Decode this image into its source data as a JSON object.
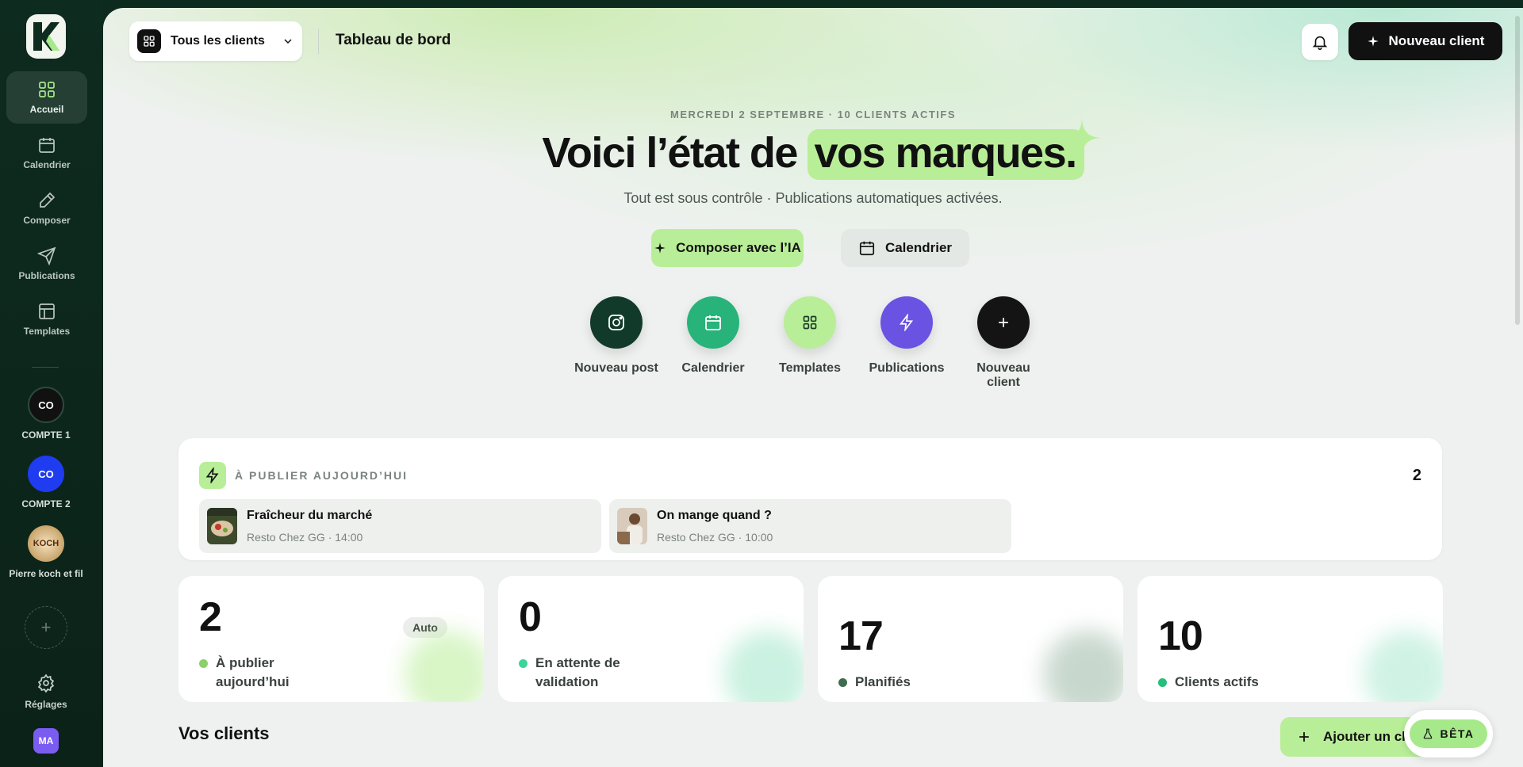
{
  "sidebar": {
    "logo_letter": "K",
    "nav": [
      {
        "label": "Accueil",
        "icon": "grid-icon",
        "active": true
      },
      {
        "label": "Calendrier",
        "icon": "calendar-icon"
      },
      {
        "label": "Composer",
        "icon": "pencil-icon"
      },
      {
        "label": "Publications",
        "icon": "send-icon"
      },
      {
        "label": "Templates",
        "icon": "layout-icon"
      }
    ],
    "accounts": [
      {
        "initials": "CO",
        "label": "COMPTE 1",
        "color": "#111111"
      },
      {
        "initials": "CO",
        "label": "COMPTE 2",
        "color": "#1f3cf0"
      },
      {
        "initials": "KOCH",
        "label": "Pierre koch et fil",
        "color": "#c9a46a"
      }
    ],
    "add_account_symbol": "+",
    "settings_label": "Réglages",
    "user_initials": "MA"
  },
  "topbar": {
    "client_select": "Tous les clients",
    "page_title": "Tableau de bord",
    "new_client_button": "Nouveau client"
  },
  "hero": {
    "date_line": "MERCREDI 2 SEPTEMBRE · 10 CLIENTS ACTIFS",
    "title_prefix": "Voici l’état de ",
    "title_highlight": "vos marques.",
    "subtitle": "Tout est sous contrôle · Publications automatiques activées.",
    "primary_button": "Composer avec l’IA",
    "secondary_button": "Calendrier"
  },
  "quick_actions": [
    {
      "label": "Nouveau post",
      "icon": "instagram-icon",
      "color": "#123a2a"
    },
    {
      "label": "Calendrier",
      "icon": "calendar-icon",
      "color": "#27b37a"
    },
    {
      "label": "Templates",
      "icon": "grid-icon",
      "color": "#b9ee98"
    },
    {
      "label": "Publications",
      "icon": "bolt-icon",
      "color": "#6a52e3"
    },
    {
      "label": "Nouveau client",
      "icon": "plus-icon",
      "color": "#141414"
    }
  ],
  "publish_today": {
    "title": "À PUBLIER AUJOURD’HUI",
    "count": "2",
    "posts": [
      {
        "title": "Fraîcheur du marché",
        "meta": "Resto Chez GG · 14:00"
      },
      {
        "title": "On mange quand ?",
        "meta": "Resto Chez GG · 10:00"
      }
    ]
  },
  "stats": [
    {
      "value": "2",
      "label_line1": "À publier",
      "label_line2": "aujourd’hui",
      "badge": "Auto",
      "dot": "#8bd06a"
    },
    {
      "value": "0",
      "label_line1": "En attente de",
      "label_line2": "validation",
      "dot": "#3dd39a"
    },
    {
      "value": "17",
      "label_line1": "Planifiés",
      "dot": "#3f6b4e"
    },
    {
      "value": "10",
      "label_line1": "Clients actifs",
      "dot": "#22c07a"
    }
  ],
  "clients_section": {
    "title": "Vos clients",
    "add_button": "Ajouter un client"
  },
  "beta_badge": "BÊTA"
}
